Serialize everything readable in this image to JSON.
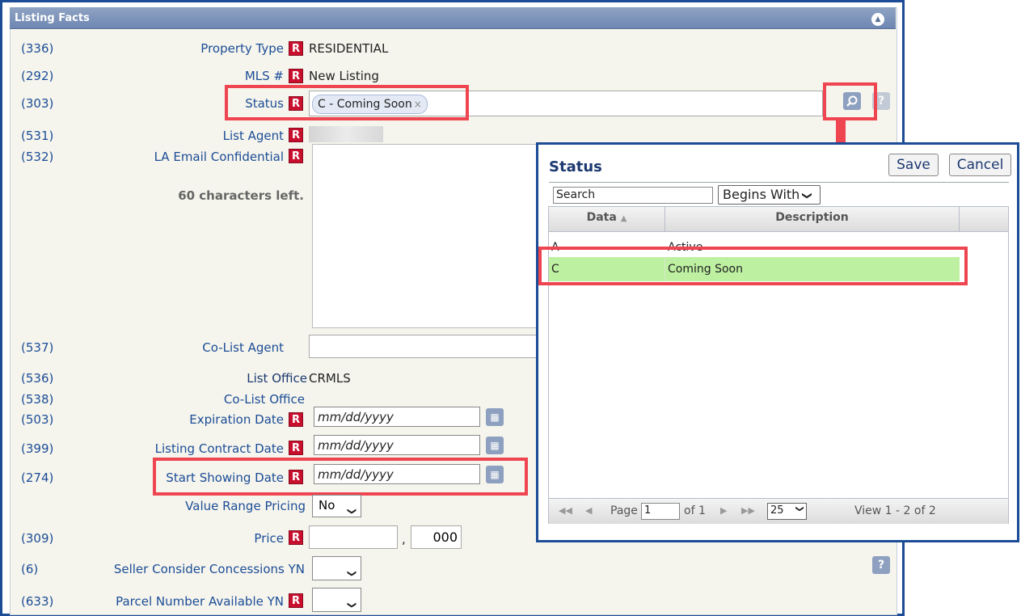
{
  "panel": {
    "title": "Listing Facts"
  },
  "fields": [
    {
      "id": "property-type",
      "num": "(336)",
      "label": "Property Type",
      "value": "RESIDENTIAL"
    },
    {
      "id": "mls-number",
      "num": "(292)",
      "label": "MLS #",
      "value": "New Listing"
    },
    {
      "id": "status",
      "num": "(303)",
      "label": "Status",
      "value": "C - Coming Soon"
    },
    {
      "id": "list-agent",
      "num": "(531)",
      "label": "List Agent"
    },
    {
      "id": "la-email-confidential",
      "num": "(532)",
      "label": "LA Email Confidential",
      "hint": "60 characters left."
    },
    {
      "id": "co-list-agent",
      "num": "(537)",
      "label": "Co-List Agent"
    },
    {
      "id": "list-office",
      "num": "(536)",
      "label": "List Office",
      "value": "CRMLS"
    },
    {
      "id": "co-list-office",
      "num": "(538)",
      "label": "Co-List Office"
    },
    {
      "id": "expiration-date",
      "num": "(503)",
      "label": "Expiration Date",
      "placeholder": "mm/dd/yyyy"
    },
    {
      "id": "listing-contract-date",
      "num": "(399)",
      "label": "Listing Contract Date",
      "placeholder": "mm/dd/yyyy"
    },
    {
      "id": "start-showing-date",
      "num": "(274)",
      "label": "Start Showing Date",
      "placeholder": "mm/dd/yyyy"
    },
    {
      "id": "value-range-pricing",
      "label": "Value Range Pricing",
      "value": "No"
    },
    {
      "id": "price",
      "num": "(309)",
      "label": "Price",
      "separator": ",",
      "value2": "000"
    },
    {
      "id": "seller-consider-concessions",
      "num": "(6)",
      "label": "Seller Consider Concessions YN"
    },
    {
      "id": "parcel-number-available",
      "num": "(633)",
      "label": "Parcel Number Available YN"
    }
  ],
  "required_mark": "R",
  "popup": {
    "title": "Status",
    "save_label": "Save",
    "cancel_label": "Cancel",
    "search_value": "Search",
    "match_mode": "Begins With",
    "columns": [
      "Data",
      "Description"
    ],
    "sort_indicator": "▲",
    "rows": [
      {
        "data": "A",
        "description": "Active",
        "selected": false
      },
      {
        "data": "C",
        "description": "Coming Soon",
        "selected": true
      }
    ],
    "pager": {
      "page_label": "Page",
      "page": "1",
      "of_label": "of 1",
      "rows_per_page": "25",
      "view_text": "View 1 - 2 of 2"
    }
  },
  "colors": {
    "accent": "#1c4c96",
    "required": "#c8102e",
    "highlight": "#bdf0a0",
    "annotation": "#ef4551"
  },
  "icons": {
    "search": "magnifier-icon",
    "help": "help-icon",
    "calendar": "calendar-icon",
    "collapse": "collapse-up-icon"
  }
}
